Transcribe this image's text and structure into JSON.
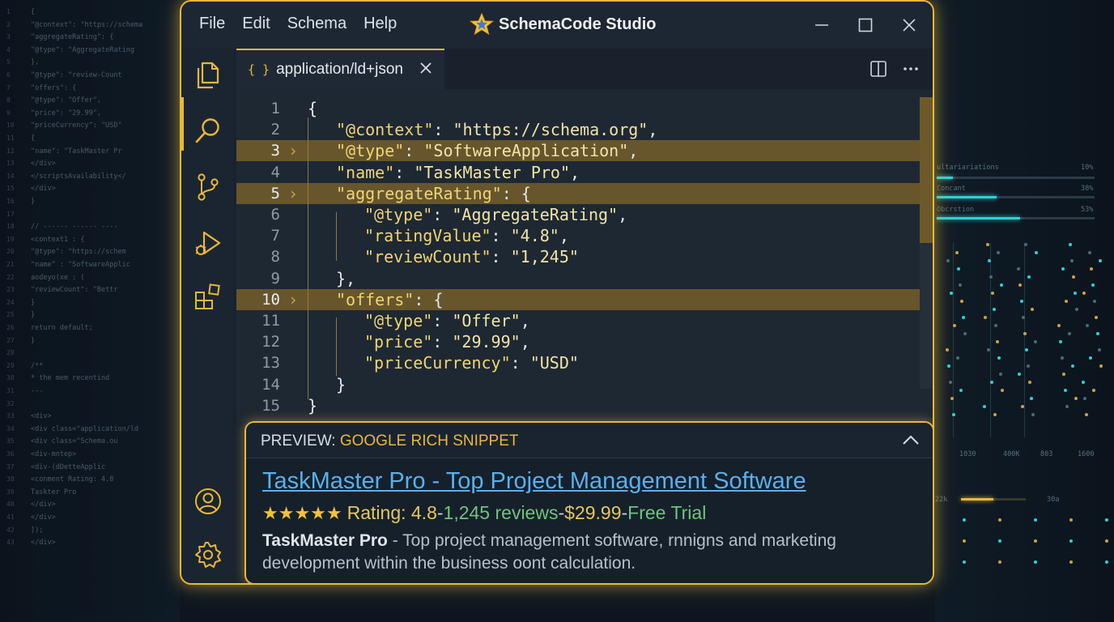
{
  "menu": [
    "File",
    "Edit",
    "Schema",
    "Help"
  ],
  "app_title": "SchemaCode Studio",
  "tab": {
    "icon_text": "{ }",
    "label": "application/ld+json"
  },
  "code_lines": [
    {
      "num": "1",
      "highlight": false,
      "fold": false,
      "indent": 0,
      "tokens": [
        {
          "t": "p",
          "v": "{"
        }
      ]
    },
    {
      "num": "2",
      "highlight": false,
      "fold": false,
      "indent": 1,
      "tokens": [
        {
          "t": "k",
          "v": "\"@context\""
        },
        {
          "t": "p",
          "v": ": "
        },
        {
          "t": "s",
          "v": "\"https://schema.org\""
        },
        {
          "t": "p",
          "v": ","
        }
      ]
    },
    {
      "num": "3",
      "highlight": true,
      "fold": true,
      "indent": 1,
      "tokens": [
        {
          "t": "k",
          "v": "\"@type\""
        },
        {
          "t": "p",
          "v": ": "
        },
        {
          "t": "s",
          "v": "\"SoftwareApplication\""
        },
        {
          "t": "p",
          "v": ","
        }
      ]
    },
    {
      "num": "4",
      "highlight": false,
      "fold": false,
      "indent": 1,
      "tokens": [
        {
          "t": "k",
          "v": "\"name\""
        },
        {
          "t": "p",
          "v": ": "
        },
        {
          "t": "s",
          "v": "\"TaskMaster Pro\""
        },
        {
          "t": "p",
          "v": ","
        }
      ]
    },
    {
      "num": "5",
      "highlight": true,
      "fold": true,
      "indent": 1,
      "tokens": [
        {
          "t": "k",
          "v": "\"aggregateRating\""
        },
        {
          "t": "p",
          "v": ": {"
        }
      ]
    },
    {
      "num": "6",
      "highlight": false,
      "fold": false,
      "indent": 2,
      "tokens": [
        {
          "t": "k",
          "v": "\"@type\""
        },
        {
          "t": "p",
          "v": ": "
        },
        {
          "t": "s",
          "v": "\"AggregateRating\""
        },
        {
          "t": "p",
          "v": ","
        }
      ]
    },
    {
      "num": "7",
      "highlight": false,
      "fold": false,
      "indent": 2,
      "tokens": [
        {
          "t": "k",
          "v": "\"ratingValue\""
        },
        {
          "t": "p",
          "v": ": "
        },
        {
          "t": "s",
          "v": "\"4.8\""
        },
        {
          "t": "p",
          "v": ","
        }
      ]
    },
    {
      "num": "8",
      "highlight": false,
      "fold": false,
      "indent": 2,
      "tokens": [
        {
          "t": "k",
          "v": "\"reviewCount\""
        },
        {
          "t": "p",
          "v": ": "
        },
        {
          "t": "s",
          "v": "\"1,245\""
        }
      ]
    },
    {
      "num": "9",
      "highlight": false,
      "fold": false,
      "indent": 1,
      "tokens": [
        {
          "t": "p",
          "v": "},"
        }
      ]
    },
    {
      "num": "10",
      "highlight": true,
      "fold": true,
      "indent": 1,
      "tokens": [
        {
          "t": "k",
          "v": "\"offers\""
        },
        {
          "t": "p",
          "v": ": {"
        }
      ]
    },
    {
      "num": "11",
      "highlight": false,
      "fold": false,
      "indent": 2,
      "tokens": [
        {
          "t": "k",
          "v": "\"@type\""
        },
        {
          "t": "p",
          "v": ": "
        },
        {
          "t": "s",
          "v": "\"Offer\""
        },
        {
          "t": "p",
          "v": ","
        }
      ]
    },
    {
      "num": "12",
      "highlight": false,
      "fold": false,
      "indent": 2,
      "tokens": [
        {
          "t": "k",
          "v": "\"price\""
        },
        {
          "t": "p",
          "v": ": "
        },
        {
          "t": "s",
          "v": "\"29.99\""
        },
        {
          "t": "p",
          "v": ","
        }
      ]
    },
    {
      "num": "13",
      "highlight": false,
      "fold": false,
      "indent": 2,
      "tokens": [
        {
          "t": "k",
          "v": "\"priceCurrency\""
        },
        {
          "t": "p",
          "v": ": "
        },
        {
          "t": "s",
          "v": "\"USD\""
        }
      ]
    },
    {
      "num": "14",
      "highlight": false,
      "fold": false,
      "indent": 1,
      "tokens": [
        {
          "t": "p",
          "v": "}"
        }
      ]
    },
    {
      "num": "15",
      "highlight": false,
      "fold": false,
      "indent": 0,
      "tokens": [
        {
          "t": "p",
          "v": "}"
        }
      ]
    }
  ],
  "preview": {
    "label_prefix": "PREVIEW: ",
    "label_highlight": "GOOGLE RICH SNIPPET",
    "title": "TaskMaster Pro - Top Project Management Software",
    "stars": "★★★★★",
    "rating_text": "Rating: 4.8",
    "sep": " - ",
    "reviews": "1,245 reviews",
    "price": "$29.99",
    "trial": "Free Trial",
    "desc_bold": "TaskMaster Pro",
    "desc_rest": " - Top project management software, rnnigns and marketing development within the business oont calculation."
  },
  "background_right": {
    "rows": [
      {
        "label": "ultariariations",
        "value": "10%",
        "fill": 0.1
      },
      {
        "label": "Concant",
        "value": "38%",
        "fill": 0.38
      },
      {
        "label": "Obcrstion",
        "value": "53%",
        "fill": 0.53
      }
    ],
    "bottom_labels": [
      "1030",
      "400K",
      "803",
      "1600"
    ],
    "stat_labels": [
      "22k",
      "30a"
    ]
  },
  "colors": {
    "accent": "#e8b83a",
    "link": "#5ab0ec",
    "green": "#6fc57b",
    "teal": "#2fd0d6"
  },
  "icons": [
    "star-logo-icon",
    "minimize-icon",
    "maximize-icon",
    "close-icon",
    "files-icon",
    "search-icon",
    "source-control-icon",
    "run-debug-icon",
    "extensions-icon",
    "account-icon",
    "settings-icon",
    "split-editor-icon",
    "more-icon",
    "chevron-up-icon",
    "fold-chevron-icon"
  ]
}
